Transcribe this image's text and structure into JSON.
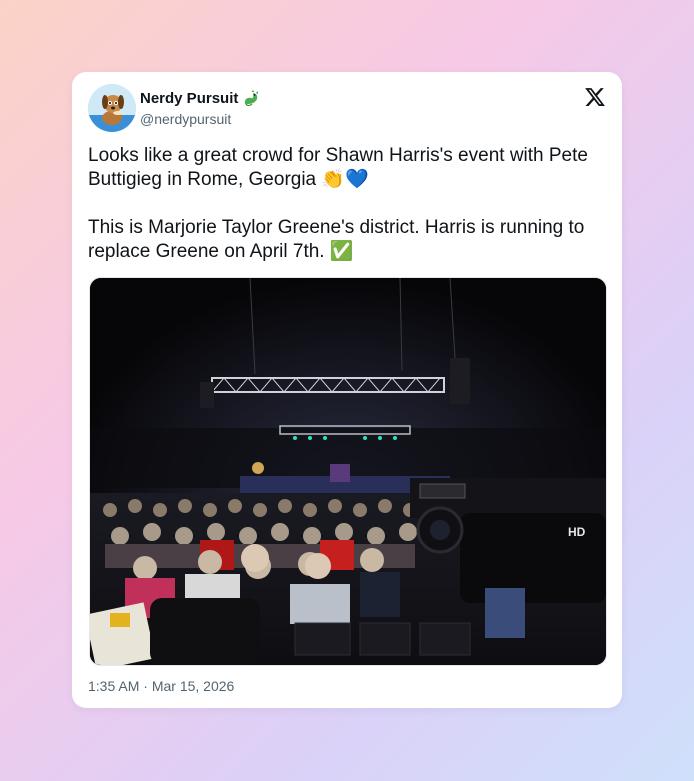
{
  "tweet": {
    "author_name": "Nerdy Pursuit",
    "author_badge_icon": "dragon-emoji",
    "handle": "@nerdypursuit",
    "paragraph1": "Looks like a great crowd for Shawn Harris's event with Pete Buttigieg in Rome, Georgia 👏💙",
    "paragraph2": "This is Marjorie Taylor Greene's district. Harris is running to replace Greene on April 7th. ✅",
    "time": "1:35 AM",
    "separator": "·",
    "date": "Mar 15, 2026",
    "platform_icon": "x-logo-icon",
    "media": {
      "camera_text": "HD"
    }
  },
  "colors": {
    "text": "#0f1419",
    "secondary": "#536471",
    "card_bg": "#ffffff"
  }
}
